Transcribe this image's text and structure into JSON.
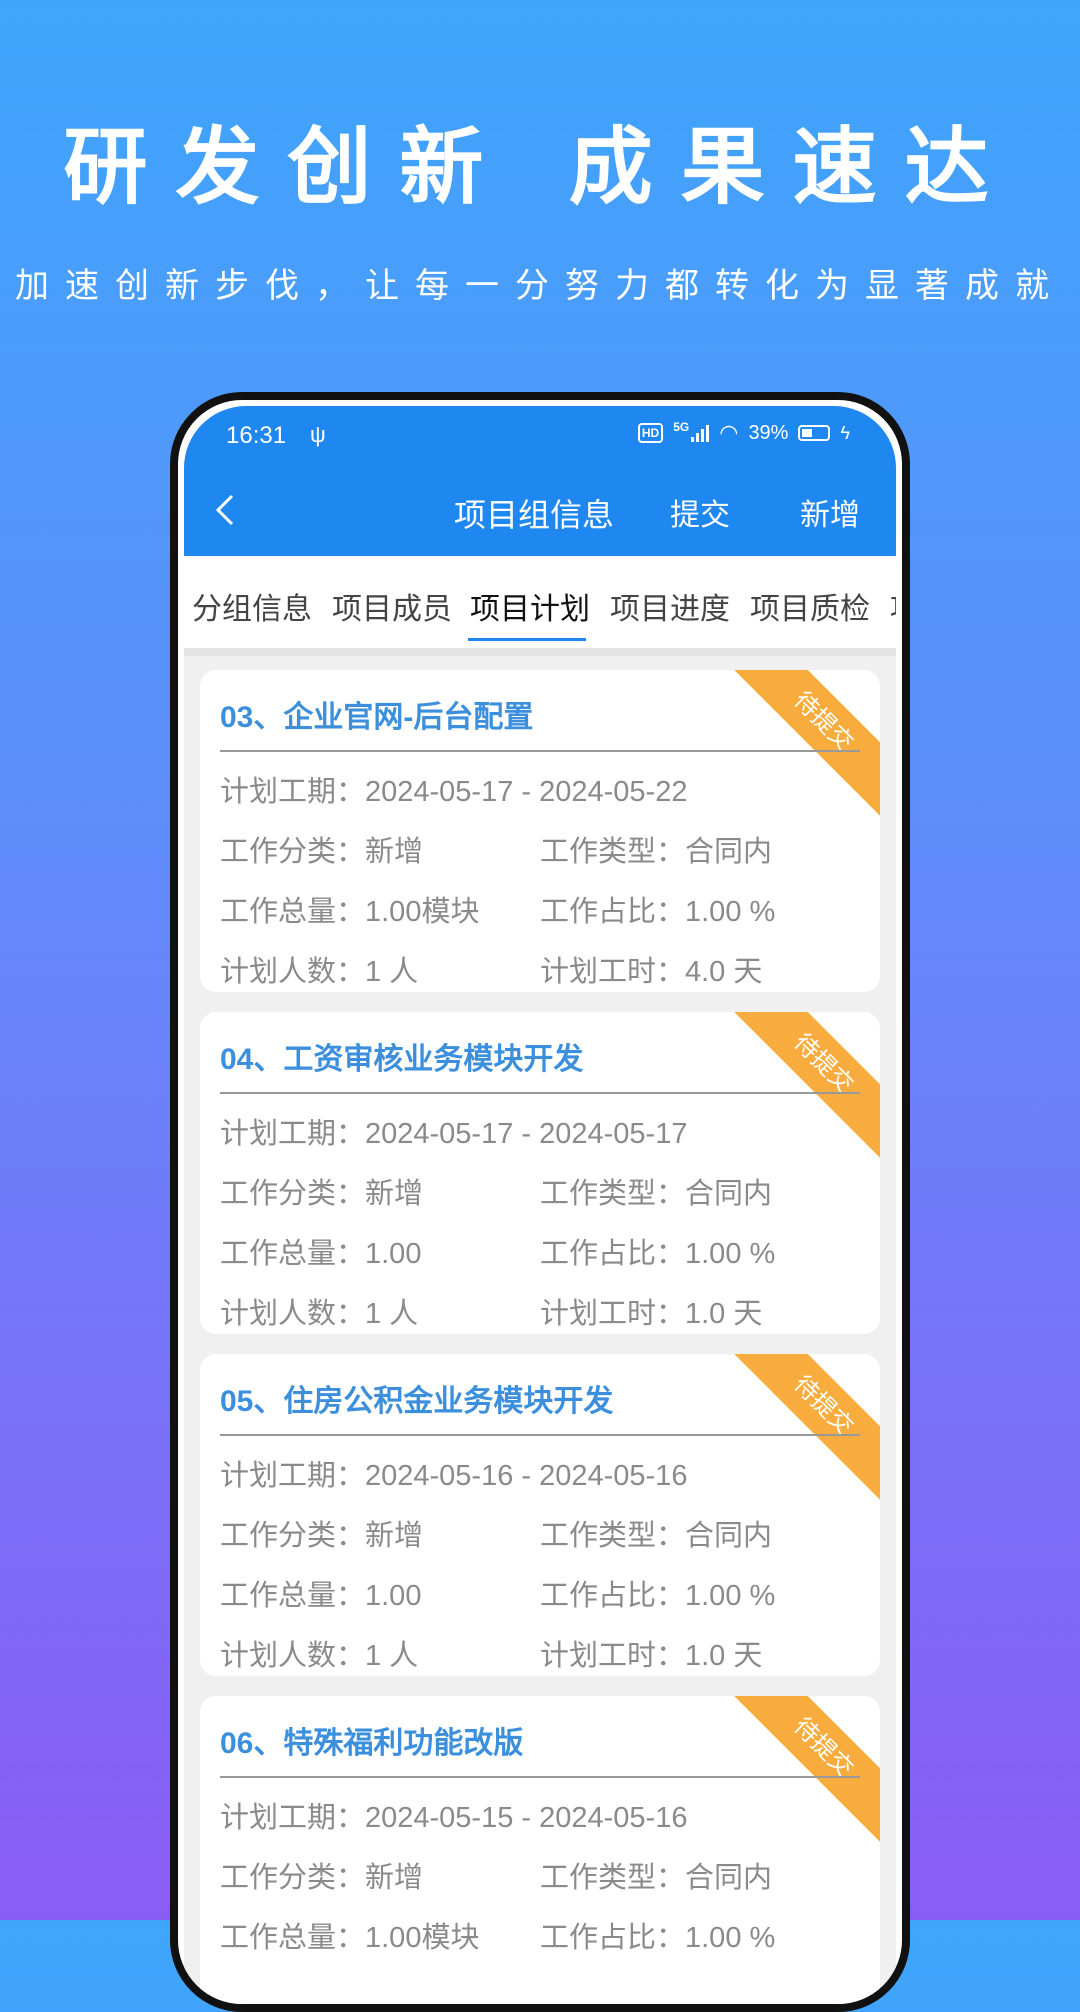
{
  "promo": {
    "title": "研发创新 成果速达",
    "subtitle": "加速创新步伐，让每一分努力都转化为显著成就"
  },
  "status_bar": {
    "time": "16:31",
    "network": "5G",
    "battery": "39%"
  },
  "nav": {
    "title": "项目组信息",
    "submit": "提交",
    "add": "新增"
  },
  "tabs": [
    {
      "label": "分组信息"
    },
    {
      "label": "项目成员"
    },
    {
      "label": "项目计划"
    },
    {
      "label": "项目进度"
    },
    {
      "label": "项目质检"
    },
    {
      "label": "项"
    }
  ],
  "cards": [
    {
      "title": "03、企业官网-后台配置",
      "status": "待提交",
      "period": "计划工期：2024-05-17 - 2024-05-22",
      "category": "工作分类：新增",
      "type": "工作类型：合同内",
      "total": "工作总量：1.00模块",
      "ratio": "工作占比：1.00 %",
      "people": "计划人数：1 人",
      "hours": "计划工时：4.0 天"
    },
    {
      "title": "04、工资审核业务模块开发",
      "status": "待提交",
      "period": "计划工期：2024-05-17 - 2024-05-17",
      "category": "工作分类：新增",
      "type": "工作类型：合同内",
      "total": "工作总量：1.00",
      "ratio": "工作占比：1.00 %",
      "people": "计划人数：1 人",
      "hours": "计划工时：1.0 天"
    },
    {
      "title": "05、住房公积金业务模块开发",
      "status": "待提交",
      "period": "计划工期：2024-05-16 - 2024-05-16",
      "category": "工作分类：新增",
      "type": "工作类型：合同内",
      "total": "工作总量：1.00",
      "ratio": "工作占比：1.00 %",
      "people": "计划人数：1 人",
      "hours": "计划工时：1.0 天"
    },
    {
      "title": "06、特殊福利功能改版",
      "status": "待提交",
      "period": "计划工期：2024-05-15 - 2024-05-16",
      "category": "工作分类：新增",
      "type": "工作类型：合同内",
      "total": "工作总量：1.00模块",
      "ratio": "工作占比：1.00 %"
    }
  ]
}
